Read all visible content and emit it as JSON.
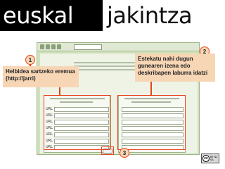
{
  "logo": {
    "left_text": "euskal",
    "right_text": "jakintza"
  },
  "callouts": [
    {
      "number": "1",
      "text": "Helbidea sartzeko eremua (http://jarri)"
    },
    {
      "number": "2",
      "text": "Estekatu nahi dugun gunearen izena edo deskribapen laburra idatzi"
    },
    {
      "number": "3"
    }
  ],
  "form": {
    "url_rows": [
      "URL 1",
      "URL 2",
      "URL 3",
      "URL 4",
      "URL 5",
      "URL 6",
      "URL 7"
    ]
  },
  "license": {
    "icon": "cc",
    "text": "BY NC SA"
  },
  "colors": {
    "callout_bg": "#f7d6b5",
    "highlight": "#e8431c",
    "form_bg": "#cfe1b9"
  }
}
